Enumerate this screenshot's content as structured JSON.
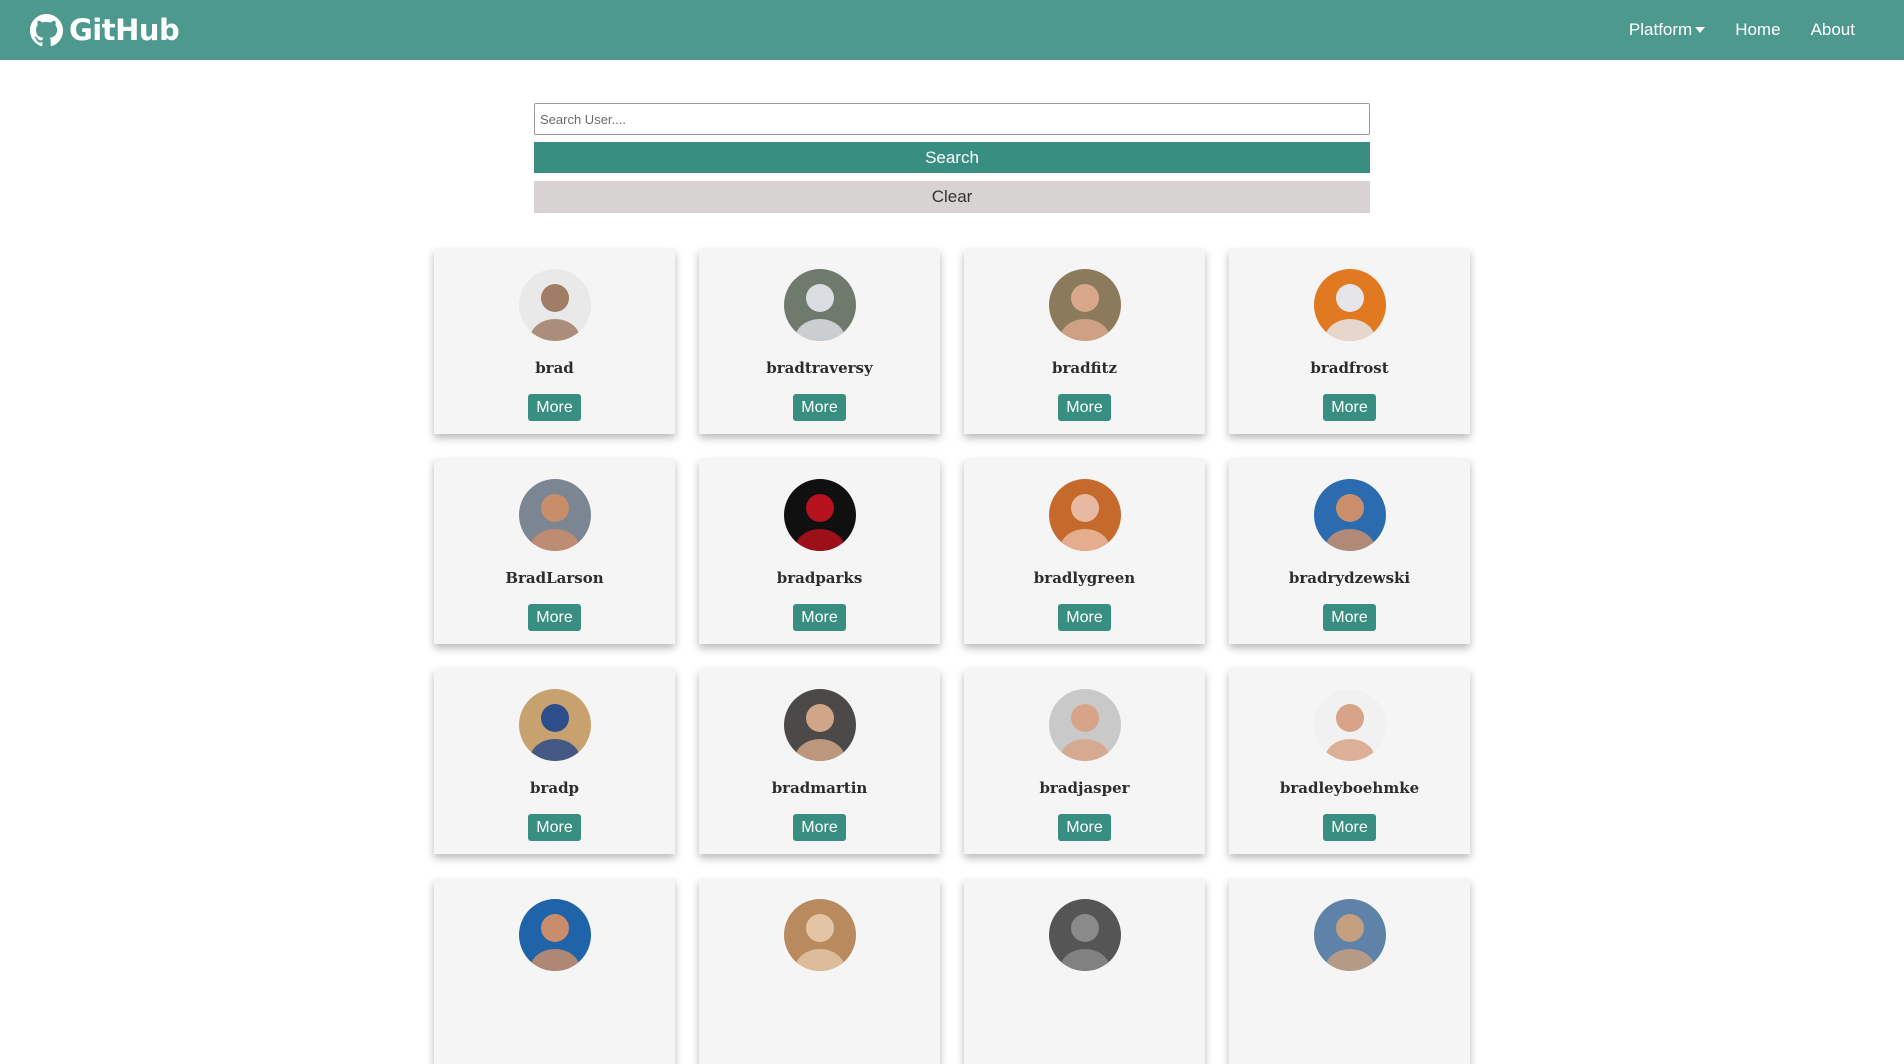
{
  "navbar": {
    "brand": "GitHub",
    "links": [
      {
        "label": "Platform",
        "dropdown": true
      },
      {
        "label": "Home"
      },
      {
        "label": "About"
      }
    ],
    "bg_color": "#4d998d"
  },
  "search": {
    "placeholder": "Search User....",
    "value": "",
    "search_label": "Search",
    "clear_label": "Clear"
  },
  "users": [
    {
      "login": "brad",
      "more": "More",
      "avatar": {
        "bg": "#e9e9ea",
        "fg": "#a07d67"
      }
    },
    {
      "login": "bradtraversy",
      "more": "More",
      "avatar": {
        "bg": "#6f7a6c",
        "fg": "#dcdde2"
      }
    },
    {
      "login": "bradfitz",
      "more": "More",
      "avatar": {
        "bg": "#8b7a5c",
        "fg": "#d9a88c"
      }
    },
    {
      "login": "bradfrost",
      "more": "More",
      "avatar": {
        "bg": "#e0791f",
        "fg": "#e6e6ea"
      }
    },
    {
      "login": "BradLarson",
      "more": "More",
      "avatar": {
        "bg": "#7c8592",
        "fg": "#c98d6c"
      }
    },
    {
      "login": "bradparks",
      "more": "More",
      "avatar": {
        "bg": "#101010",
        "fg": "#b5121b"
      }
    },
    {
      "login": "bradlygreen",
      "more": "More",
      "avatar": {
        "bg": "#c56a2c",
        "fg": "#e7b9a0"
      }
    },
    {
      "login": "bradrydzewski",
      "more": "More",
      "avatar": {
        "bg": "#2b6bb0",
        "fg": "#c98f6d"
      }
    },
    {
      "login": "bradp",
      "more": "More",
      "avatar": {
        "bg": "#c7a26e",
        "fg": "#2d4e8a"
      }
    },
    {
      "login": "bradmartin",
      "more": "More",
      "avatar": {
        "bg": "#4c4a48",
        "fg": "#d1a587"
      }
    },
    {
      "login": "bradjasper",
      "more": "More",
      "avatar": {
        "bg": "#c9c9c9",
        "fg": "#d8a487"
      }
    },
    {
      "login": "bradleyboehmke",
      "more": "More",
      "avatar": {
        "bg": "#f1f1f1",
        "fg": "#d8a487"
      }
    },
    {
      "login": "",
      "more": "",
      "avatar": {
        "bg": "#1f64a8",
        "fg": "#c98d6c"
      }
    },
    {
      "login": "",
      "more": "",
      "avatar": {
        "bg": "#b88a5e",
        "fg": "#e3c4a4"
      }
    },
    {
      "login": "",
      "more": "",
      "avatar": {
        "bg": "#555555",
        "fg": "#8a8a8a"
      }
    },
    {
      "login": "",
      "more": "",
      "avatar": {
        "bg": "#5f82a8",
        "fg": "#c4a080"
      }
    }
  ]
}
